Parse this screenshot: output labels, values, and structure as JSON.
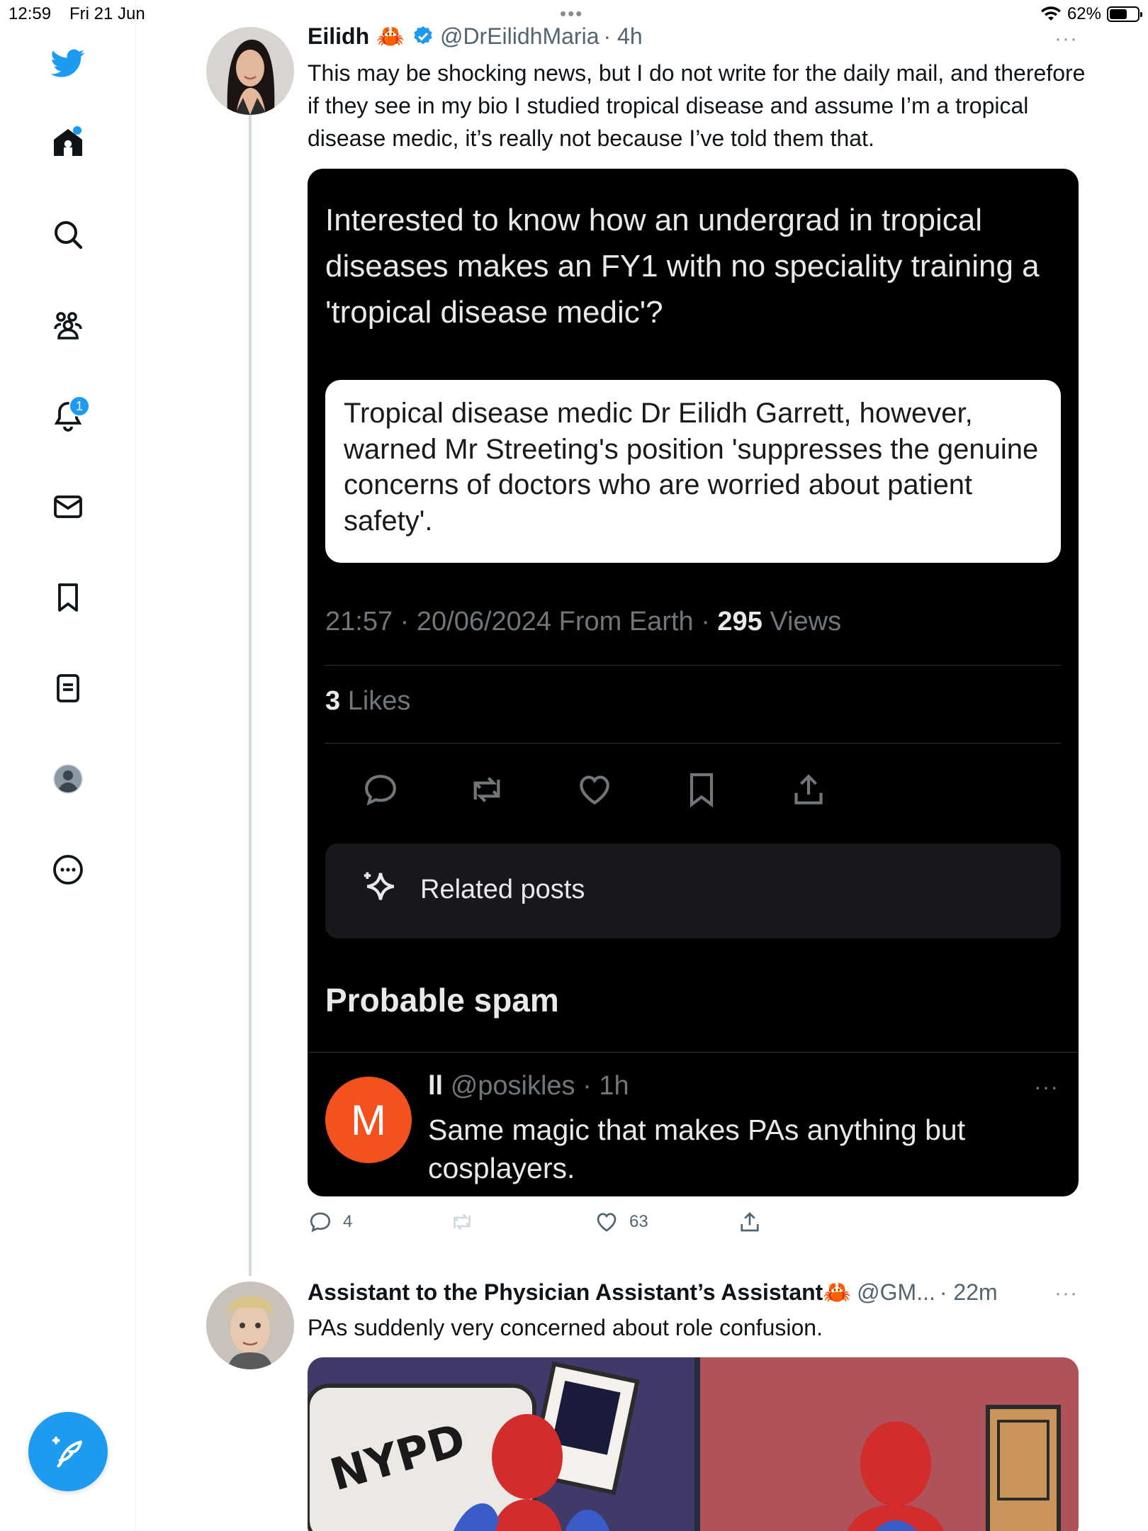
{
  "status_bar": {
    "time": "12:59",
    "date": "Fri 21 Jun",
    "battery_text": "62%",
    "battery_level": 0.62
  },
  "sidebar": {
    "items": [
      {
        "icon": "twitter-logo-icon"
      },
      {
        "icon": "home-icon",
        "has_dot": true
      },
      {
        "icon": "search-icon"
      },
      {
        "icon": "communities-icon"
      },
      {
        "icon": "notifications-icon",
        "badge": "1"
      },
      {
        "icon": "messages-icon"
      },
      {
        "icon": "bookmarks-icon"
      },
      {
        "icon": "lists-icon"
      },
      {
        "icon": "profile-icon"
      },
      {
        "icon": "more-icon"
      }
    ],
    "compose_icon": "compose-icon"
  },
  "tweet1": {
    "name": "Eilidh",
    "emoji": "🦀",
    "handle": "@DrEilidhMaria",
    "time": "· 4h",
    "more": "···",
    "text": "This may be shocking news,  but I do not write for the daily mail, and therefore if they see in my bio I studied tropical disease and assume I’m a tropical disease medic, it’s really not because I’ve told them that.",
    "embed": {
      "question": "Interested to know how an undergrad in tropical diseases makes an FY1 with no speciality training a 'tropical disease medic'?",
      "quote": "Tropical disease medic Dr Eilidh Garrett, however, warned Mr Streeting's position 'suppresses the genuine concerns of doctors who are worried about patient safety'.",
      "meta_prefix": "21:57 · 20/06/2024 From Earth · ",
      "views_count": "295",
      "views_label": " Views",
      "likes_count": "3",
      "likes_label": " Likes",
      "related_label": "Related posts",
      "spam_title": "Probable spam",
      "spam_reply": {
        "avatar_letter": "M",
        "name": "ll",
        "handle": "@posikles",
        "time": "· 1h",
        "more": "···",
        "text": "Same magic that makes PAs anything but cosplayers."
      }
    },
    "actions": {
      "reply_count": "4",
      "retweet_count": "",
      "like_count": "63"
    }
  },
  "tweet2": {
    "name": "Assistant to the Physician Assistant’s Assistant",
    "emoji": "🦀",
    "handle": "@GM...",
    "time": "· 22m",
    "more": "···",
    "text": "PAs suddenly very concerned about role confusion.",
    "image_text": "NYPD"
  },
  "colors": {
    "brand": "#1d9bf0",
    "spam_avatar": "#f4511e",
    "embed_bg": "#000000"
  }
}
